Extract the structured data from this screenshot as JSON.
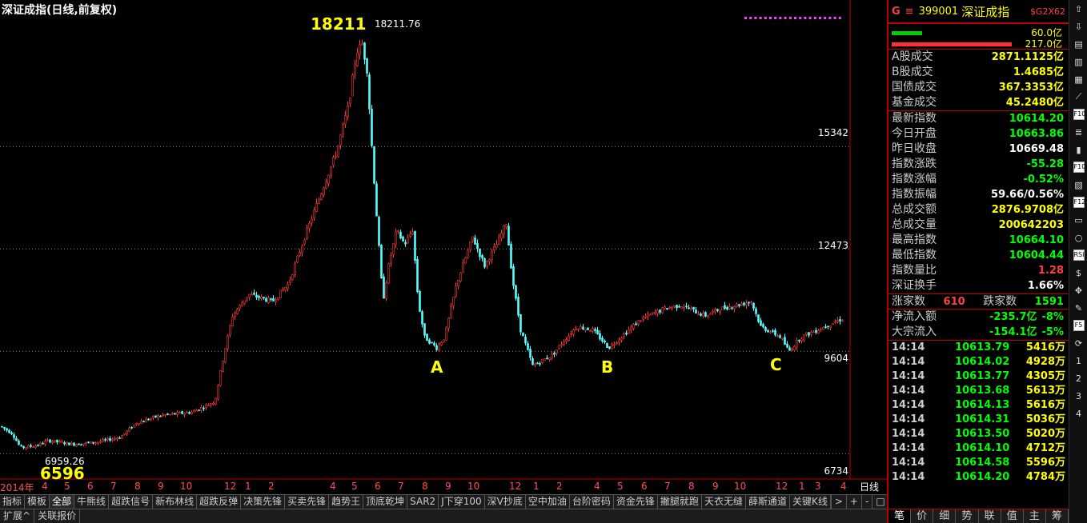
{
  "chart_title": "深证成指(日线,前复权)",
  "high_mark": "18211",
  "high_label": "18211.76",
  "low_mark": "6596",
  "low_label": "6959.26",
  "wave_labels": [
    "A",
    "B",
    "C"
  ],
  "y_ticks": [
    "15342",
    "12473",
    "9604",
    "6734"
  ],
  "x_ticks": [
    "2014年",
    "4",
    "5",
    "6",
    "7",
    "8",
    "9",
    "10",
    "12",
    "1",
    "2",
    "4",
    "5",
    "6",
    "7",
    "8",
    "9",
    "10",
    "12",
    "1",
    "2",
    "4",
    "5",
    "6",
    "7",
    "8",
    "9",
    "10",
    "12",
    "1",
    "3",
    "4"
  ],
  "x_unit": "日线",
  "indicator_tabs": [
    "指标",
    "模板",
    "全部",
    "牛熊线",
    "超跌信号",
    "新布林线",
    "超跌反弹",
    "决策先锋",
    "买卖先锋",
    "趋势王",
    "顶底乾坤",
    "SAR2",
    "J下穿100",
    "深V抄底",
    "空中加油",
    "台阶密码",
    "资金先锋",
    "撇腿就跑",
    "天衣无缝",
    "薛斯通道",
    "关键K线"
  ],
  "active_tab": "全部",
  "tab_nav": [
    ">",
    "+",
    "-",
    "□"
  ],
  "bottom_tabs": [
    "扩展^",
    "关联报价"
  ],
  "panel": {
    "g_label": "G",
    "menu_icon": "≡",
    "code": "399001",
    "name": "深证成指",
    "sg_label": "$G2X62",
    "vol_up": "60.0亿",
    "vol_down": "217.0亿",
    "section1": [
      {
        "label": "A股成交",
        "value": "2871.1125亿",
        "color": "#ffff00"
      },
      {
        "label": "B股成交",
        "value": "1.4685亿",
        "color": "#ffff00"
      },
      {
        "label": "国债成交",
        "value": "367.3353亿",
        "color": "#ffff00"
      },
      {
        "label": "基金成交",
        "value": "45.2480亿",
        "color": "#ffff00"
      }
    ],
    "section2": [
      {
        "label": "最新指数",
        "value": "10614.20",
        "color": "#00ff00"
      },
      {
        "label": "今日开盘",
        "value": "10663.86",
        "color": "#00ff00"
      },
      {
        "label": "昨日收盘",
        "value": "10669.48",
        "color": "#ffffff"
      },
      {
        "label": "指数涨跌",
        "value": "-55.28",
        "color": "#00ff00"
      },
      {
        "label": "指数涨幅",
        "value": "-0.52%",
        "color": "#00ff00"
      },
      {
        "label": "指数振幅",
        "value": "59.66/0.56%",
        "color": "#ffffff"
      },
      {
        "label": "总成交额",
        "value": "2876.9708亿",
        "color": "#ffff00"
      },
      {
        "label": "总成交量",
        "value": "200642203",
        "color": "#ffff00"
      },
      {
        "label": "最高指数",
        "value": "10664.10",
        "color": "#00ff00"
      },
      {
        "label": "最低指数",
        "value": "10604.44",
        "color": "#00ff00"
      },
      {
        "label": "指数量比",
        "value": "1.28",
        "color": "#ff4040"
      },
      {
        "label": "深证换手",
        "value": "1.66%",
        "color": "#ffffff"
      }
    ],
    "rise_label": "涨家数",
    "rise_count": "610",
    "fall_label": "跌家数",
    "fall_count": "1591",
    "flow": [
      {
        "label": "净流入额",
        "value": "-235.7亿",
        "pct": "-8%"
      },
      {
        "label": "大宗流入",
        "value": "-154.1亿",
        "pct": "-5%"
      }
    ],
    "ticks": [
      {
        "time": "14:14",
        "price": "10613.79",
        "vol": "5416万"
      },
      {
        "time": "14:14",
        "price": "10614.02",
        "vol": "4928万"
      },
      {
        "time": "14:14",
        "price": "10613.77",
        "vol": "4305万"
      },
      {
        "time": "14:14",
        "price": "10613.68",
        "vol": "5613万"
      },
      {
        "time": "14:14",
        "price": "10614.13",
        "vol": "5616万"
      },
      {
        "time": "14:14",
        "price": "10614.31",
        "vol": "5036万"
      },
      {
        "time": "14:14",
        "price": "10613.50",
        "vol": "5020万"
      },
      {
        "time": "14:14",
        "price": "10614.10",
        "vol": "4712万"
      },
      {
        "time": "14:14",
        "price": "10614.58",
        "vol": "5596万"
      },
      {
        "time": "14:14",
        "price": "10614.20",
        "vol": "4784万"
      }
    ],
    "bottom_tabs": [
      "笔",
      "价",
      "细",
      "势",
      "联",
      "值",
      "主",
      "筹"
    ]
  },
  "toolbar": [
    {
      "icon": "up-arrow-icon",
      "glyph": "⇧"
    },
    {
      "icon": "down-arrow-icon",
      "glyph": "⇩"
    },
    {
      "icon": "intraday-chart-icon",
      "glyph": "▤"
    },
    {
      "icon": "kline-chart-icon",
      "glyph": "▥"
    },
    {
      "icon": "grid-icon",
      "glyph": "▦"
    },
    {
      "icon": "trend-icon",
      "glyph": "⟋"
    },
    {
      "icon": "f10-icon",
      "glyph": "F10"
    },
    {
      "icon": "list-icon",
      "glyph": "≣"
    },
    {
      "icon": "bar-chart-icon",
      "glyph": "▮"
    },
    {
      "icon": "f10b-icon",
      "glyph": "F10"
    },
    {
      "icon": "stats-icon",
      "glyph": "▧"
    },
    {
      "icon": "f12-icon",
      "glyph": "F12"
    },
    {
      "icon": "monitor-icon",
      "glyph": "▭"
    },
    {
      "icon": "circle-icon",
      "glyph": "○"
    },
    {
      "icon": "rsi-icon",
      "glyph": "RSI"
    },
    {
      "icon": "dollar-icon",
      "glyph": "$"
    },
    {
      "icon": "move-icon",
      "glyph": "✥"
    },
    {
      "icon": "pen-icon",
      "glyph": "✎"
    },
    {
      "icon": "f5-icon",
      "glyph": "F5"
    },
    {
      "icon": "refresh-icon",
      "glyph": "⟳"
    },
    {
      "icon": "nav-1",
      "glyph": "1"
    },
    {
      "icon": "nav-2",
      "glyph": "2"
    },
    {
      "icon": "nav-3",
      "glyph": "3"
    },
    {
      "icon": "nav-4",
      "glyph": "4"
    }
  ],
  "chart_data": {
    "type": "candlestick",
    "title": "深证成指(日线,前复权)",
    "ylim": [
      6000,
      19000
    ],
    "y_grid": [
      15342,
      12473,
      9604,
      6734
    ],
    "up_color": "#ff3232",
    "down_color": "#54ffff",
    "high": 18211.76,
    "low": 6959.26,
    "path": [
      [
        0,
        7500
      ],
      [
        15,
        7300
      ],
      [
        25,
        6900
      ],
      [
        45,
        6960
      ],
      [
        60,
        7100
      ],
      [
        90,
        7000
      ],
      [
        120,
        7050
      ],
      [
        150,
        7200
      ],
      [
        170,
        7600
      ],
      [
        200,
        7800
      ],
      [
        240,
        7900
      ],
      [
        268,
        8200
      ],
      [
        280,
        9600
      ],
      [
        290,
        10600
      ],
      [
        310,
        11200
      ],
      [
        340,
        11000
      ],
      [
        360,
        11500
      ],
      [
        380,
        12800
      ],
      [
        400,
        14000
      ],
      [
        420,
        15200
      ],
      [
        435,
        16500
      ],
      [
        445,
        18000
      ],
      [
        452,
        18211
      ],
      [
        458,
        17500
      ],
      [
        465,
        15000
      ],
      [
        472,
        12800
      ],
      [
        478,
        11000
      ],
      [
        485,
        12000
      ],
      [
        495,
        13000
      ],
      [
        505,
        12600
      ],
      [
        515,
        13000
      ],
      [
        522,
        11000
      ],
      [
        530,
        10000
      ],
      [
        545,
        9700
      ],
      [
        555,
        10000
      ],
      [
        570,
        11500
      ],
      [
        590,
        12800
      ],
      [
        605,
        12000
      ],
      [
        620,
        12600
      ],
      [
        632,
        13200
      ],
      [
        640,
        11600
      ],
      [
        650,
        10200
      ],
      [
        665,
        9200
      ],
      [
        690,
        9500
      ],
      [
        700,
        9800
      ],
      [
        720,
        10300
      ],
      [
        740,
        10200
      ],
      [
        760,
        9700
      ],
      [
        780,
        10100
      ],
      [
        800,
        10500
      ],
      [
        830,
        10800
      ],
      [
        850,
        10900
      ],
      [
        880,
        10600
      ],
      [
        900,
        10800
      ],
      [
        920,
        10900
      ],
      [
        938,
        11000
      ],
      [
        950,
        10300
      ],
      [
        975,
        10000
      ],
      [
        985,
        9600
      ],
      [
        1000,
        10000
      ],
      [
        1020,
        10200
      ],
      [
        1050,
        10500
      ]
    ],
    "x_tick_offsets_note": "month labels along time axis"
  }
}
